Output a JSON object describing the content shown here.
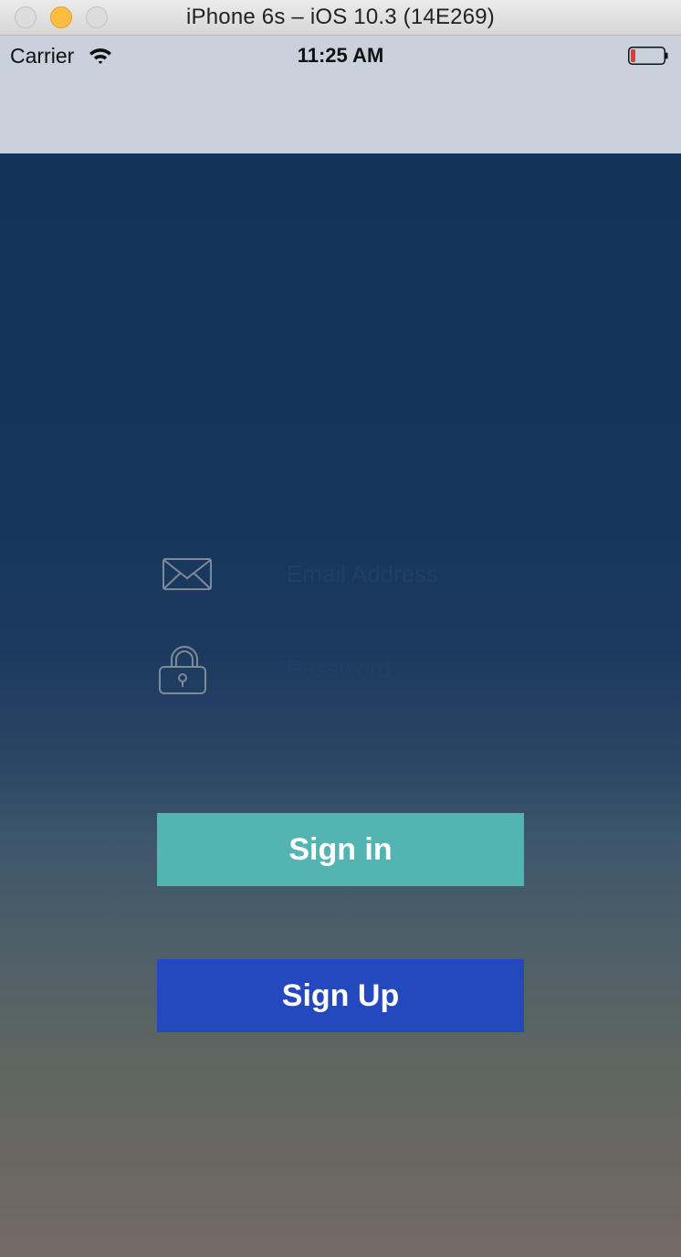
{
  "window": {
    "title": "iPhone 6s – iOS 10.3 (14E269)"
  },
  "status_bar": {
    "carrier": "Carrier",
    "time": "11:25 AM",
    "icons": [
      "wifi-icon",
      "battery-icon"
    ]
  },
  "login": {
    "email": {
      "icon": "envelope-icon",
      "value": "",
      "placeholder": "Email Address"
    },
    "password": {
      "icon": "lock-icon",
      "value": "",
      "placeholder": "Password"
    },
    "signin_label": "Sign in",
    "signup_label": "Sign Up"
  },
  "colors": {
    "signin_button": "#53b4b2",
    "signup_button": "#2448be",
    "background_top": "#13335a",
    "background_bottom": "#736a66",
    "navbar": "#c9d1dd"
  }
}
